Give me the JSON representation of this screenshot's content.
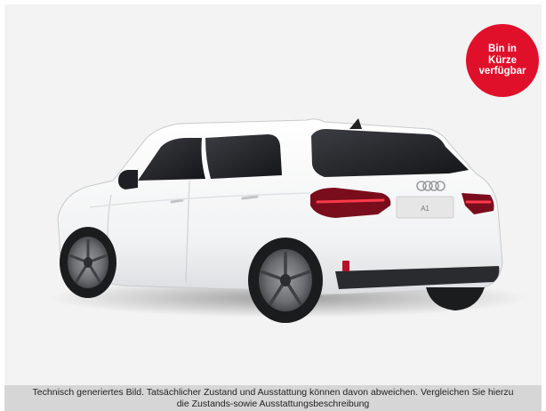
{
  "badge": {
    "line1": "Bin in",
    "line2": "Kürze",
    "line3": "verfügbar",
    "color": "#e0102a"
  },
  "vehicle": {
    "plate_text": "A1",
    "body_color": "#ffffff"
  },
  "caption": {
    "line1": "Technisch generiertes Bild. Tatsächlicher Zustand und Ausstattung können davon abweichen. Vergleichen Sie hierzu",
    "line2": "die Zustands-sowie Ausstattungsbeschreibung"
  }
}
